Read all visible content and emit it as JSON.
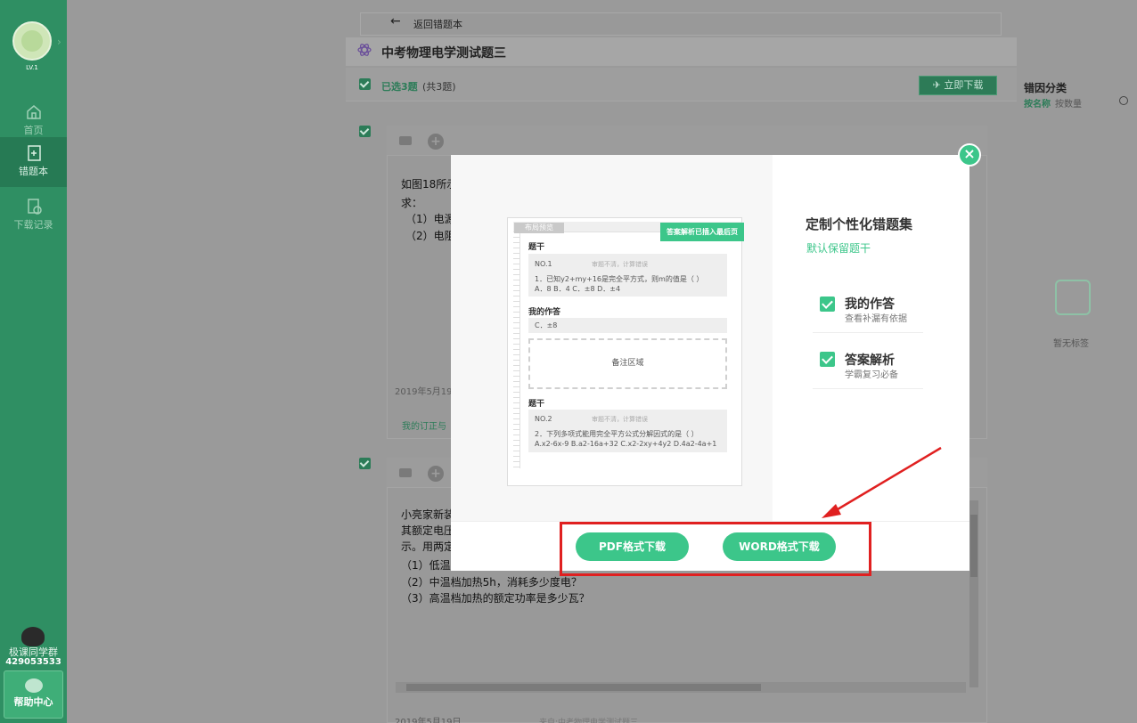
{
  "sidebar": {
    "level": "LV.1",
    "nav": [
      {
        "label": "首页",
        "icon": "home-icon"
      },
      {
        "label": "错题本",
        "icon": "notebook-icon"
      },
      {
        "label": "下载记录",
        "icon": "download-record-icon"
      }
    ],
    "qq_group_label": "极课同学群",
    "qq_group_number": "429053533",
    "help_label": "帮助中心"
  },
  "topbar": {
    "back_label": "返回错题本"
  },
  "page": {
    "title": "中考物理电学测试题三"
  },
  "selection": {
    "selected": "已选3题",
    "total": "(共3题)",
    "download_now": "立即下载"
  },
  "right_panel": {
    "title": "错因分类",
    "sort_by_name": "按名称",
    "sort_by_count": "按数量",
    "empty_tags": "暂无标签"
  },
  "cards": [
    {
      "lines": [
        "如图18所示",
        "求：",
        "（1）电源",
        "（2）电阻"
      ],
      "date": "2019年5月19",
      "fix_label": "我的订正与"
    },
    {
      "lines": [
        "小亮家新装",
        "其额定电压",
        "示。用两定",
        "（1）低温",
        "（2）中温档加热5h，消耗多少度电？",
        "（3）高温档加热的额定功率是多少瓦？"
      ],
      "date": "2019年5月19日",
      "source": "来自:中考物理电学测试题三"
    }
  ],
  "modal": {
    "preview": {
      "layout_label": "布局预览",
      "answer_badge": "答案解析已插入最后页",
      "section_stem": "题干",
      "q1_no": "NO.1",
      "q1_tag": "审题不清，计算错误",
      "q1_text": "1．已知y2+my+16是完全平方式，则m的值是（   ）",
      "q1_options": "A．8  B．4  C．±8  D．±4",
      "my_answer_label": "我的作答",
      "my_answer": "C．±8",
      "notes_label": "备注区域",
      "section_stem2": "题干",
      "q2_no": "NO.2",
      "q2_tag": "审题不清，计算错误",
      "q2_text": "2．下列多项式能用完全平方公式分解因式的是（   ）",
      "q2_options": "A.x2-6x-9    B.a2-16a+32    C.x2-2xy+4y2    D.4a2-4a+1"
    },
    "title": "定制个性化错题集",
    "default_keep": "默认保留题干",
    "options": [
      {
        "label": "我的作答",
        "sub": "查看补漏有依据"
      },
      {
        "label": "答案解析",
        "sub": "学霸复习必备"
      }
    ],
    "pdf_button": "PDF格式下载",
    "word_button": "WORD格式下载"
  },
  "colors": {
    "accent": "#3cc68a",
    "sidebar": "#2f8f63",
    "highlight": "#e02020"
  }
}
